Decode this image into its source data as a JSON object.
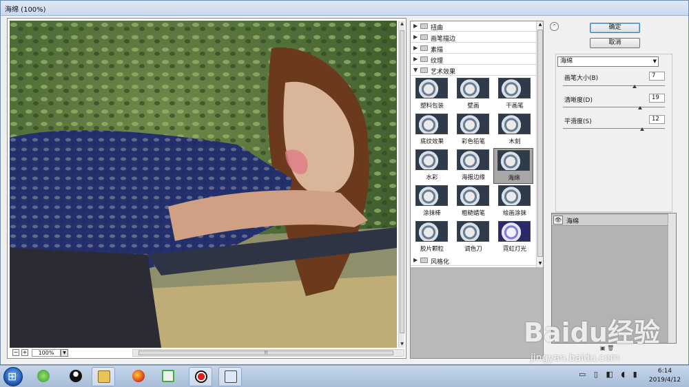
{
  "window": {
    "title": "海绵 (100%)"
  },
  "preview": {
    "zoom": "100%",
    "zoom_out": "−",
    "zoom_in": "+"
  },
  "gallery": {
    "categories_top": [
      "扭曲",
      "画笔描边",
      "素描",
      "纹理",
      "艺术效果"
    ],
    "expanded": "艺术效果",
    "filters": [
      "塑料包装",
      "壁画",
      "干画笔",
      "底纹效果",
      "彩色铅笔",
      "木刻",
      "水彩",
      "海报边缘",
      "海绵",
      "涂抹棒",
      "粗糙蜡笔",
      "绘画涂抹",
      "胶片颗粒",
      "调色刀",
      "霓虹灯光"
    ],
    "selected": "海绵",
    "categories_bottom": [
      "风格化"
    ]
  },
  "buttons": {
    "ok": "确定",
    "cancel": "取消"
  },
  "params": {
    "filter_name": "海绵",
    "brush_size": {
      "label": "画笔大小(B)",
      "value": "7",
      "fraction": 0.7
    },
    "definition": {
      "label": "清晰度(D)",
      "value": "19",
      "fraction": 0.76
    },
    "smoothness": {
      "label": "平滑度(S)",
      "value": "12",
      "fraction": 0.78
    }
  },
  "layers": {
    "name": "海绵"
  },
  "taskbar": {
    "time": "6:14",
    "date": "2019/4/12"
  },
  "watermark": {
    "brand": "Baidu经验",
    "url": "jingyan.baidu.com"
  }
}
